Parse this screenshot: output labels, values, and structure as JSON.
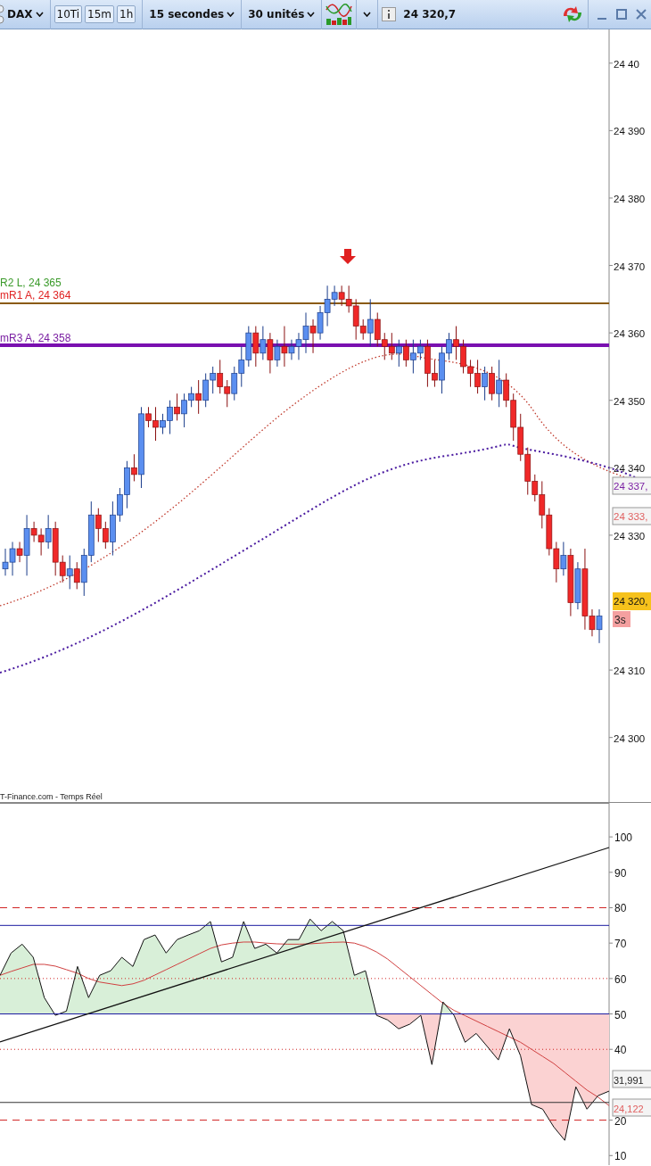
{
  "toolbar": {
    "symbol": "DAX",
    "intervals": [
      {
        "label": "10Ti",
        "selected": false
      },
      {
        "label": "15m",
        "selected": false
      },
      {
        "label": "1h",
        "selected": false
      }
    ],
    "period": "15 secondes",
    "units": "30 unités",
    "last_price": "24 320,7"
  },
  "price_chart": {
    "level_labels": [
      {
        "text": "R2 L, 24 365",
        "color": "#3a9a2a"
      },
      {
        "text": "mR1 A, 24 364",
        "color": "#e02424"
      },
      {
        "text": "mR3 A, 24 358",
        "color": "#7a1fa2"
      }
    ],
    "tags": [
      {
        "text": "24 337,",
        "kind": "ma",
        "color": "#7a1fa2"
      },
      {
        "text": "24 333,",
        "kind": "ma",
        "color": "#e06060"
      },
      {
        "text": "24 320,",
        "kind": "last"
      }
    ],
    "countdown": "3s",
    "source": "T-Finance.com - Temps Réel",
    "chart_data": {
      "type": "candlestick",
      "ylim": [
        24290.3,
        24405.0
      ],
      "yticks": [
        {
          "value": 24400,
          "label": "24 40"
        },
        {
          "value": 24390,
          "label": "24 390"
        },
        {
          "value": 24380,
          "label": "24 380"
        },
        {
          "value": 24370,
          "label": "24 370"
        },
        {
          "value": 24360,
          "label": "24 360"
        },
        {
          "value": 24350,
          "label": "24 350"
        },
        {
          "value": 24340,
          "label": "24 340"
        },
        {
          "value": 24330,
          "label": "24 330"
        },
        {
          "value": 24310,
          "label": "24 310"
        },
        {
          "value": 24300,
          "label": "24 300"
        }
      ],
      "ohlc": [
        [
          24325,
          24328,
          24324,
          24326
        ],
        [
          24326,
          24329,
          24324,
          24328
        ],
        [
          24328,
          24329,
          24326,
          24327
        ],
        [
          24327,
          24333,
          24324,
          24331
        ],
        [
          24331,
          24332,
          24329,
          24330
        ],
        [
          24330,
          24331,
          24327,
          24329
        ],
        [
          24329,
          24333,
          24328,
          24331
        ],
        [
          24331,
          24332,
          24324,
          24326
        ],
        [
          24326,
          24327,
          24323,
          24324
        ],
        [
          24324,
          24327,
          24322,
          24325
        ],
        [
          24325,
          24326,
          24322,
          24323
        ],
        [
          24323,
          24328,
          24321,
          24327
        ],
        [
          24327,
          24335,
          24326,
          24333
        ],
        [
          24333,
          24334,
          24329,
          24331
        ],
        [
          24331,
          24332,
          24328,
          24329
        ],
        [
          24329,
          24335,
          24327,
          24333
        ],
        [
          24333,
          24337,
          24332,
          24336
        ],
        [
          24336,
          24341,
          24334,
          24340
        ],
        [
          24340,
          24342,
          24338,
          24339
        ],
        [
          24339,
          24349,
          24337,
          24348
        ],
        [
          24348,
          24349,
          24346,
          24347
        ],
        [
          24347,
          24349,
          24344,
          24346
        ],
        [
          24346,
          24348,
          24345,
          24347
        ],
        [
          24347,
          24350,
          24345,
          24349
        ],
        [
          24349,
          24351,
          24347,
          24348
        ],
        [
          24348,
          24351,
          24346,
          24350
        ],
        [
          24350,
          24352,
          24349,
          24351
        ],
        [
          24351,
          24353,
          24348,
          24350
        ],
        [
          24350,
          24354,
          24349,
          24353
        ],
        [
          24353,
          24355,
          24351,
          24354
        ],
        [
          24354,
          24356,
          24351,
          24352
        ],
        [
          24352,
          24353,
          24349,
          24351
        ],
        [
          24351,
          24355,
          24350,
          24354
        ],
        [
          24354,
          24358,
          24352,
          24356
        ],
        [
          24356,
          24361,
          24355,
          24360
        ],
        [
          24360,
          24361,
          24355,
          24357
        ],
        [
          24357,
          24361,
          24356,
          24359
        ],
        [
          24359,
          24360,
          24354,
          24356
        ],
        [
          24356,
          24359,
          24355,
          24358
        ],
        [
          24358,
          24361,
          24355,
          24357
        ],
        [
          24357,
          24359,
          24356,
          24358
        ],
        [
          24358,
          24360,
          24356,
          24359
        ],
        [
          24359,
          24363,
          24357,
          24361
        ],
        [
          24361,
          24362,
          24357,
          24360
        ],
        [
          24360,
          24364,
          24359,
          24363
        ],
        [
          24363,
          24367,
          24361,
          24365
        ],
        [
          24365,
          24367,
          24364,
          24366
        ],
        [
          24366,
          24367,
          24364,
          24365
        ],
        [
          24365,
          24367,
          24363,
          24364
        ],
        [
          24364,
          24365,
          24359,
          24361
        ],
        [
          24361,
          24362,
          24359,
          24360
        ],
        [
          24360,
          24365,
          24358,
          24362
        ],
        [
          24362,
          24363,
          24358,
          24359
        ],
        [
          24359,
          24360,
          24356,
          24358
        ],
        [
          24358,
          24360,
          24356,
          24357
        ],
        [
          24357,
          24359,
          24355,
          24358
        ],
        [
          24358,
          24359,
          24355,
          24356
        ],
        [
          24356,
          24359,
          24354,
          24357
        ],
        [
          24357,
          24359,
          24356,
          24358
        ],
        [
          24358,
          24359,
          24352,
          24354
        ],
        [
          24354,
          24356,
          24352,
          24353
        ],
        [
          24353,
          24358,
          24351,
          24357
        ],
        [
          24357,
          24360,
          24356,
          24359
        ],
        [
          24359,
          24361,
          24356,
          24358
        ],
        [
          24358,
          24359,
          24354,
          24355
        ],
        [
          24355,
          24356,
          24352,
          24354
        ],
        [
          24354,
          24356,
          24351,
          24352
        ],
        [
          24352,
          24355,
          24350,
          24354
        ],
        [
          24354,
          24355,
          24350,
          24351
        ],
        [
          24351,
          24356,
          24349,
          24353
        ],
        [
          24353,
          24354,
          24349,
          24350
        ],
        [
          24350,
          24351,
          24344,
          24346
        ],
        [
          24346,
          24348,
          24341,
          24342
        ],
        [
          24342,
          24343,
          24336,
          24338
        ],
        [
          24338,
          24339,
          24335,
          24336
        ],
        [
          24336,
          24338,
          24331,
          24333
        ],
        [
          24333,
          24334,
          24327,
          24328
        ],
        [
          24328,
          24329,
          24323,
          24325
        ],
        [
          24325,
          24329,
          24324,
          24327
        ],
        [
          24327,
          24328,
          24318,
          24320
        ],
        [
          24320,
          24326,
          24319,
          24325
        ],
        [
          24325,
          24328,
          24316,
          24318
        ],
        [
          24318,
          24319,
          24315,
          24316
        ],
        [
          24316,
          24319,
          24314,
          24318
        ]
      ]
    }
  },
  "indicator": {
    "tags": [
      {
        "text": "31,991",
        "color": "#222222"
      },
      {
        "text": "24,122",
        "color": "#e06060"
      }
    ],
    "chart_data": {
      "type": "line",
      "ylim": [
        7.3,
        109.6
      ],
      "grid": true,
      "yticks": [
        {
          "value": 100,
          "label": "100"
        },
        {
          "value": 90,
          "label": "90"
        },
        {
          "value": 80,
          "label": "80"
        },
        {
          "value": 70,
          "label": "70"
        },
        {
          "value": 60,
          "label": "60"
        },
        {
          "value": 50,
          "label": "50"
        },
        {
          "value": 40,
          "label": "40"
        },
        {
          "value": 20,
          "label": "20"
        },
        {
          "value": 10,
          "label": "10"
        }
      ],
      "series": [
        {
          "color": "#111111",
          "values": [
            60.9,
            67.2,
            69.7,
            66.0,
            54.6,
            49.6,
            50.8,
            63.4,
            54.6,
            60.9,
            62.2,
            66.0,
            63.4,
            71.0,
            72.3,
            67.2,
            71.0,
            72.3,
            73.5,
            76.1,
            64.7,
            66.0,
            76.1,
            68.5,
            69.7,
            67.2,
            71.0,
            71.0,
            76.8,
            73.5,
            76.1,
            73.5,
            60.9,
            62.2,
            49.6,
            48.3,
            45.8,
            47.1,
            49.6,
            35.7,
            53.4,
            49.6,
            42.0,
            44.5,
            40.8,
            37.0,
            45.8,
            38.2,
            24.4,
            23.1,
            18.1,
            14.3,
            29.4,
            23.1,
            26.9,
            28.2
          ]
        },
        {
          "color": "#d04040",
          "values": [
            60.9,
            62,
            63,
            64,
            64,
            63.5,
            62.5,
            61.5,
            60,
            59,
            58.5,
            58,
            58.5,
            59.5,
            61,
            62.5,
            64,
            65.5,
            67,
            68.5,
            69.5,
            70,
            70.3,
            70.3,
            70,
            69.8,
            69.7,
            69.7,
            69.8,
            70,
            70.2,
            70.3,
            70,
            69,
            67.5,
            65.5,
            63,
            60.5,
            58,
            55.5,
            53,
            51,
            49.5,
            48,
            46.5,
            45,
            43.5,
            42,
            40,
            38,
            36,
            33.5,
            31,
            28.5,
            26.5,
            24.1
          ]
        }
      ]
    }
  }
}
